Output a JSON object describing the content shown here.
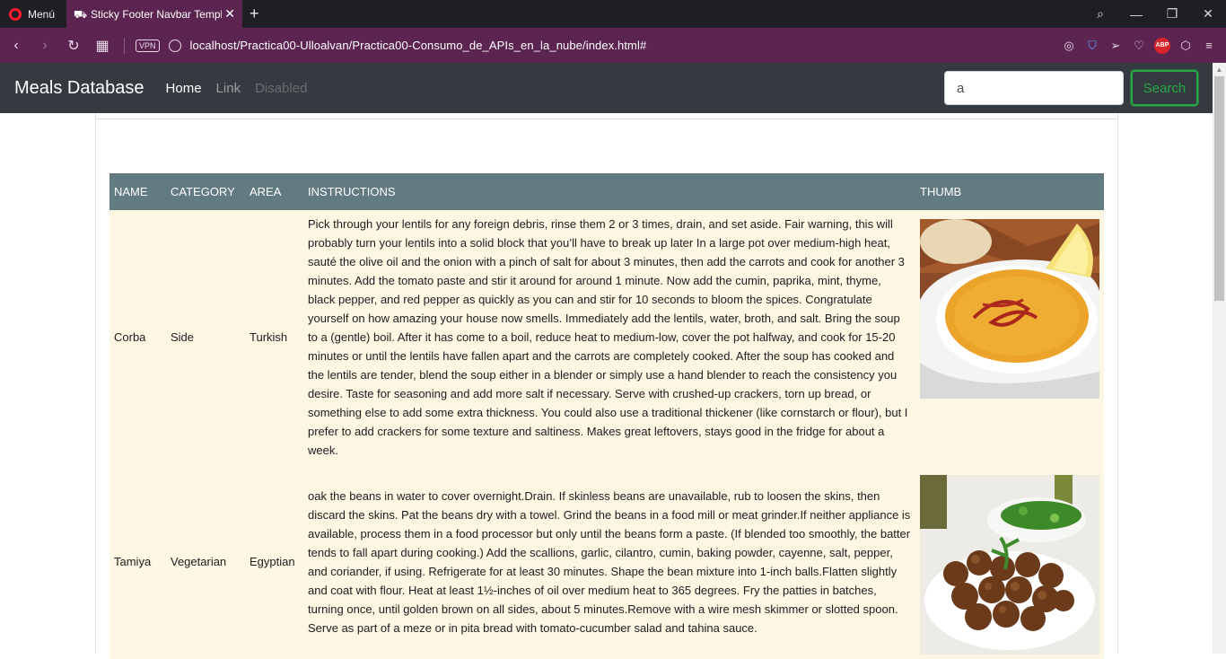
{
  "browser": {
    "menu_label": "Menú",
    "tab_title": "Sticky Footer Navbar Template",
    "url": "localhost/Practica00-Ulloalvan/Practica00-Consumo_de_APIs_en_la_nube/index.html#",
    "vpn_label": "VPN",
    "abp_label": "ABP"
  },
  "navbar": {
    "brand": "Meals Database",
    "links": [
      {
        "label": "Home",
        "state": "active"
      },
      {
        "label": "Link",
        "state": "normal"
      },
      {
        "label": "Disabled",
        "state": "disabled"
      }
    ],
    "search": {
      "value": "a",
      "button_label": "Search"
    }
  },
  "table": {
    "headers": [
      "NAME",
      "CATEGORY",
      "AREA",
      "INSTRUCTIONS",
      "THUMB"
    ],
    "rows": [
      {
        "name": "Corba",
        "category": "Side",
        "area": "Turkish",
        "instructions": "Pick through your lentils for any foreign debris, rinse them 2 or 3 times, drain, and set aside. Fair warning, this will probably turn your lentils into a solid block that you’ll have to break up later In a large pot over medium-high heat, sauté the olive oil and the onion with a pinch of salt for about 3 minutes, then add the carrots and cook for another 3 minutes. Add the tomato paste and stir it around for around 1 minute. Now add the cumin, paprika, mint, thyme, black pepper, and red pepper as quickly as you can and stir for 10 seconds to bloom the spices. Congratulate yourself on how amazing your house now smells. Immediately add the lentils, water, broth, and salt. Bring the soup to a (gentle) boil. After it has come to a boil, reduce heat to medium-low, cover the pot halfway, and cook for 15-20 minutes or until the lentils have fallen apart and the carrots are completely cooked. After the soup has cooked and the lentils are tender, blend the soup either in a blender or simply use a hand blender to reach the consistency you desire. Taste for seasoning and add more salt if necessary. Serve with crushed-up crackers, torn up bread, or something else to add some extra thickness. You could also use a traditional thickener (like cornstarch or flour), but I prefer to add crackers for some texture and saltiness. Makes great leftovers, stays good in the fridge for about a week."
      },
      {
        "name": "Tamiya",
        "category": "Vegetarian",
        "area": "Egyptian",
        "instructions": "oak the beans in water to cover overnight.Drain. If skinless beans are unavailable, rub to loosen the skins, then discard the skins. Pat the beans dry with a towel. Grind the beans in a food mill or meat grinder.If neither appliance is available, process them in a food processor but only until the beans form a paste. (If blended too smoothly, the batter tends to fall apart during cooking.) Add the scallions, garlic, cilantro, cumin, baking powder, cayenne, salt, pepper, and coriander, if using. Refrigerate for at least 30 minutes. Shape the bean mixture into 1-inch balls.Flatten slightly and coat with flour. Heat at least 1½-inches of oil over medium heat to 365 degrees. Fry the patties in batches, turning once, until golden brown on all sides, about 5 minutes.Remove with a wire mesh skimmer or slotted spoon. Serve as part of a meze or in pita bread with tomato-cucumber salad and tahina sauce."
      }
    ]
  },
  "colors": {
    "browser_accent": "#5c2451",
    "navbar_bg": "#343a40",
    "table_header_bg": "#627a82",
    "row_bg": "#fdf6e3",
    "search_green": "#28a745"
  }
}
